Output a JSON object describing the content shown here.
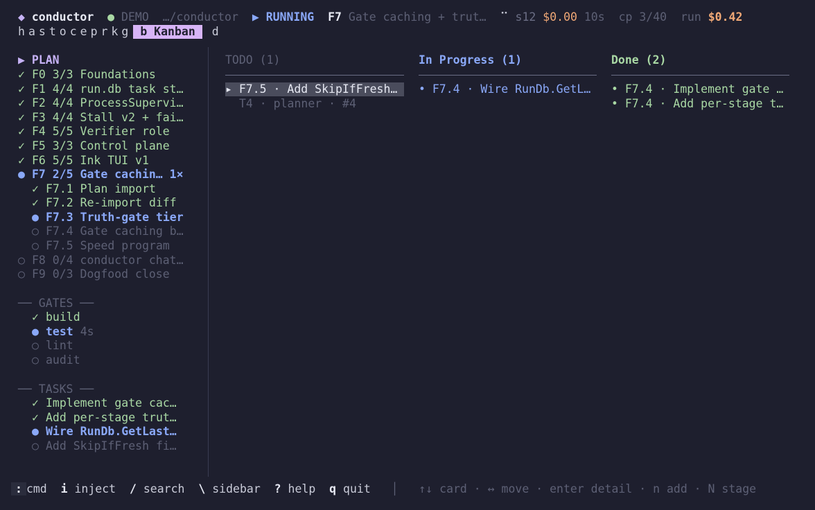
{
  "header": {
    "diamond": "◆",
    "app": "conductor",
    "mode_dot": "●",
    "mode": "DEMO",
    "path": "…/conductor",
    "state_icon": "▶",
    "state": "RUNNING",
    "feature_id": "F7",
    "feature_title": "Gate caching + trut…",
    "spinner": "⠉",
    "session": "s12",
    "session_cost": "$0.00",
    "elapsed": "10s",
    "checkpoint": "cp 3/40",
    "run_label": "run",
    "run_cost": "$0.42"
  },
  "tabs": [
    {
      "key": "h"
    },
    {
      "key": "a"
    },
    {
      "key": "s"
    },
    {
      "key": "t"
    },
    {
      "key": "o"
    },
    {
      "key": "c"
    },
    {
      "key": "e"
    },
    {
      "key": "p"
    },
    {
      "key": "r"
    },
    {
      "key": "k"
    },
    {
      "key": "g"
    }
  ],
  "active_tab": "b Kanban",
  "tab_after": "d",
  "sidebar": {
    "plan_header": "▶ PLAN",
    "features": [
      {
        "mark": "✓",
        "text": "F0 3/3 Foundations"
      },
      {
        "mark": "✓",
        "text": "F1 4/4 run.db task st…"
      },
      {
        "mark": "✓",
        "text": "F2 4/4 ProcessSupervi…"
      },
      {
        "mark": "✓",
        "text": "F3 4/4 Stall v2 + fai…"
      },
      {
        "mark": "✓",
        "text": "F4 5/5 Verifier role"
      },
      {
        "mark": "✓",
        "text": "F5 3/3 Control plane"
      },
      {
        "mark": "✓",
        "text": "F6 5/5 Ink TUI v1"
      },
      {
        "mark": "●",
        "text": "F7 2/5 Gate cachin… 1×"
      }
    ],
    "subfeatures": [
      {
        "mark": "✓",
        "text": "F7.1 Plan import"
      },
      {
        "mark": "✓",
        "text": "F7.2 Re-import diff"
      },
      {
        "mark": "●",
        "text": "F7.3 Truth-gate tier"
      },
      {
        "mark": "○",
        "text": "F7.4 Gate caching b…"
      },
      {
        "mark": "○",
        "text": "F7.5 Speed program"
      }
    ],
    "pending": [
      {
        "mark": "○",
        "text": "F8 0/4 conductor chat…"
      },
      {
        "mark": "○",
        "text": "F9 0/3 Dogfood close"
      }
    ],
    "gates_header": "── GATES ──",
    "gates": [
      {
        "mark": "✓",
        "text": "build",
        "extra": ""
      },
      {
        "mark": "●",
        "text": "test",
        "extra": "4s"
      },
      {
        "mark": "○",
        "text": "lint",
        "extra": ""
      },
      {
        "mark": "○",
        "text": "audit",
        "extra": ""
      }
    ],
    "tasks_header": "── TASKS ──",
    "tasks": [
      {
        "mark": "✓",
        "text": "Implement gate cac…"
      },
      {
        "mark": "✓",
        "text": "Add per-stage trut…"
      },
      {
        "mark": "●",
        "text": "Wire RunDb.GetLast…"
      },
      {
        "mark": "○",
        "text": "Add SkipIfFresh fi…"
      }
    ]
  },
  "kanban": {
    "todo": {
      "title": "TODO (1)",
      "cards": [
        {
          "text": "▸ F7.5 · Add SkipIfFresh…",
          "meta": "T4 · planner · #4"
        }
      ]
    },
    "in_progress": {
      "title": "In Progress (1)",
      "cards": [
        {
          "text": "• F7.4 · Wire RunDb.GetL…"
        }
      ]
    },
    "done": {
      "title": "Done (2)",
      "cards": [
        {
          "text": "• F7.4 · Implement gate …"
        },
        {
          "text": "• F7.4 · Add per-stage t…"
        }
      ]
    }
  },
  "footer": {
    "cmd_key": ":",
    "cmd": "cmd",
    "inject_key": "i",
    "inject": "inject",
    "search_key": "/",
    "search": "search",
    "sidebar_key": "\\",
    "sidebar": "sidebar",
    "help_key": "?",
    "help": "help",
    "quit_key": "q",
    "quit": "quit",
    "sep": "│",
    "hints": "↑↓ card · ↔ move · enter detail · n add · N stage"
  },
  "colors": {
    "background": "#1e1f2e",
    "accent_blue": "#8aa8f8",
    "done_green": "#a9d8a4",
    "cost_orange": "#f0a876",
    "active_tab": "#d7b4f7"
  }
}
